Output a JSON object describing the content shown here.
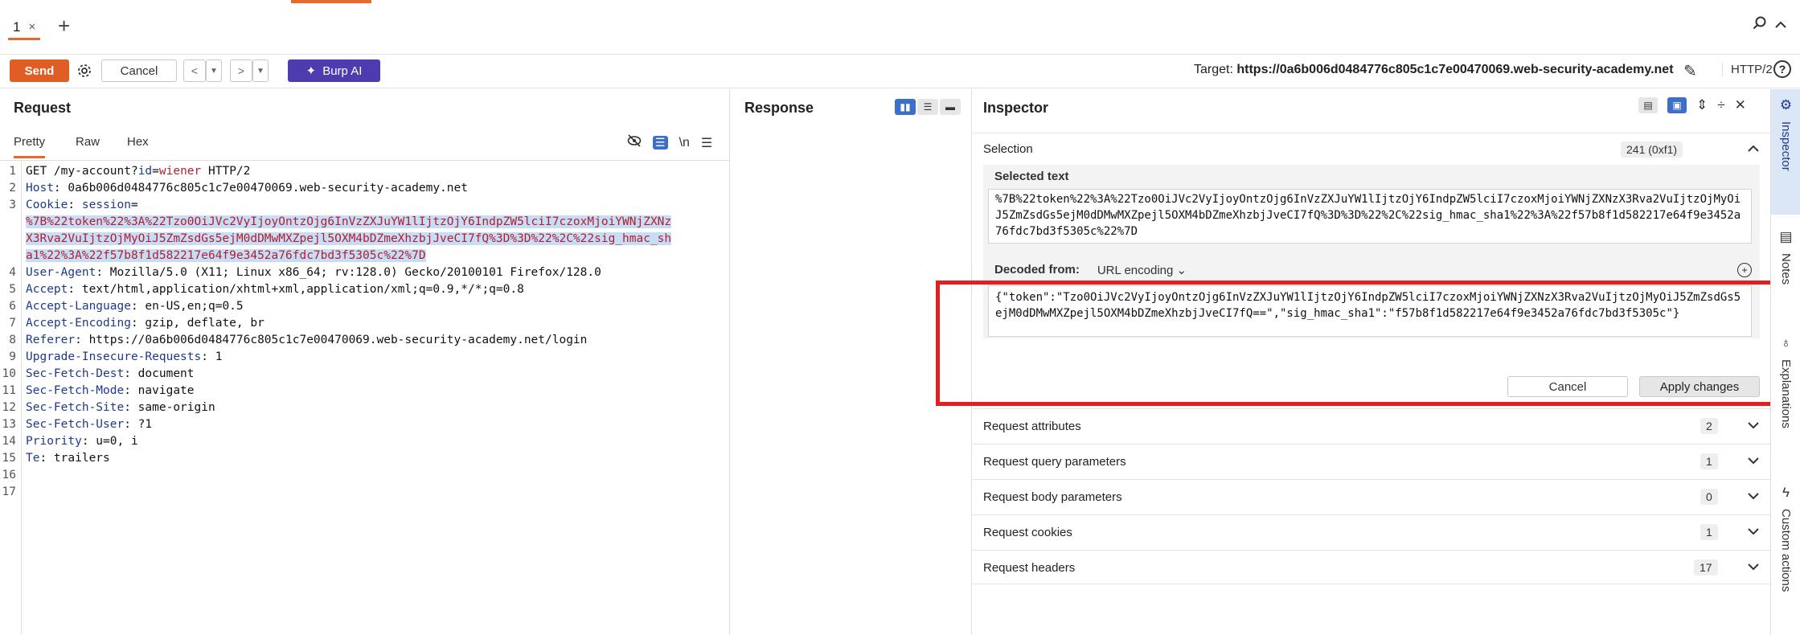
{
  "tabs": {
    "active_tab": "1",
    "close_glyph": "×",
    "add_glyph": "+"
  },
  "toolbar": {
    "send_label": "Send",
    "cancel_label": "Cancel",
    "burp_ai_label": "Burp AI",
    "target_prefix": "Target:",
    "target_url": "https://0a6b006d0484776c805c1c7e00470069.web-security-academy.net",
    "http_version": "HTTP/2",
    "help_glyph": "?"
  },
  "request": {
    "title": "Request",
    "subtabs": [
      "Pretty",
      "Raw",
      "Hex"
    ],
    "newline_toggle": "\\n",
    "lines": [
      {
        "n": "1",
        "parts": [
          [
            "",
            "GET /my-account?"
          ],
          [
            "pr",
            "id"
          ],
          [
            "",
            "="
          ],
          [
            "pv",
            "wiener"
          ],
          [
            "",
            " HTTP/2"
          ]
        ]
      },
      {
        "n": "2",
        "parts": [
          [
            "hn",
            "Host"
          ],
          [
            "",
            ": 0a6b006d0484776c805c1c7e00470069.web-security-academy.net"
          ]
        ]
      },
      {
        "n": "3",
        "parts": [
          [
            "hn",
            "Cookie"
          ],
          [
            "",
            ": "
          ],
          [
            "ck",
            "session"
          ],
          [
            "",
            "="
          ]
        ]
      },
      {
        "n": "",
        "parts": [
          [
            "sel",
            "%7B%22token%22%3A%22Tzo0OiJVc2VyIjoyOntzOjg6InVzZXJuYW1lIjtzOjY6IndpZW5lciI7czoxMjoiYWNjZXNz"
          ]
        ]
      },
      {
        "n": "",
        "parts": [
          [
            "sel",
            "X3Rva2VuIjtzOjMyOiJ5ZmZsdGs5ejM0dDMwMXZpejl5OXM4bDZmeXhzbjJveCI7fQ%3D%3D%22%2C%22sig_hmac_sh"
          ]
        ]
      },
      {
        "n": "",
        "parts": [
          [
            "sel",
            "a1%22%3A%22f57b8f1d582217e64f9e3452a76fdc7bd3f5305c%22%7D"
          ]
        ]
      },
      {
        "n": "4",
        "parts": [
          [
            "hn",
            "User-Agent"
          ],
          [
            "",
            ": Mozilla/5.0 (X11; Linux x86_64; rv:128.0) Gecko/20100101 Firefox/128.0"
          ]
        ]
      },
      {
        "n": "5",
        "parts": [
          [
            "hn",
            "Accept"
          ],
          [
            "",
            ": text/html,application/xhtml+xml,application/xml;q=0.9,*/*;q=0.8"
          ]
        ]
      },
      {
        "n": "6",
        "parts": [
          [
            "hn",
            "Accept-Language"
          ],
          [
            "",
            ": en-US,en;q=0.5"
          ]
        ]
      },
      {
        "n": "7",
        "parts": [
          [
            "hn",
            "Accept-Encoding"
          ],
          [
            "",
            ": gzip, deflate, br"
          ]
        ]
      },
      {
        "n": "8",
        "parts": [
          [
            "hn",
            "Referer"
          ],
          [
            "",
            ": https://0a6b006d0484776c805c1c7e00470069.web-security-academy.net/login"
          ]
        ]
      },
      {
        "n": "9",
        "parts": [
          [
            "hn",
            "Upgrade-Insecure-Requests"
          ],
          [
            "",
            ": 1"
          ]
        ]
      },
      {
        "n": "10",
        "parts": [
          [
            "hn",
            "Sec-Fetch-Dest"
          ],
          [
            "",
            ": document"
          ]
        ]
      },
      {
        "n": "11",
        "parts": [
          [
            "hn",
            "Sec-Fetch-Mode"
          ],
          [
            "",
            ": navigate"
          ]
        ]
      },
      {
        "n": "12",
        "parts": [
          [
            "hn",
            "Sec-Fetch-Site"
          ],
          [
            "",
            ": same-origin"
          ]
        ]
      },
      {
        "n": "13",
        "parts": [
          [
            "hn",
            "Sec-Fetch-User"
          ],
          [
            "",
            ": ?1"
          ]
        ]
      },
      {
        "n": "14",
        "parts": [
          [
            "hn",
            "Priority"
          ],
          [
            "",
            ": u=0, i"
          ]
        ]
      },
      {
        "n": "15",
        "parts": [
          [
            "hn",
            "Te"
          ],
          [
            "",
            ": trailers"
          ]
        ]
      },
      {
        "n": "16",
        "parts": []
      },
      {
        "n": "17",
        "parts": []
      }
    ]
  },
  "response": {
    "title": "Response"
  },
  "inspector": {
    "title": "Inspector",
    "selection_label": "Selection",
    "selection_count": "241 (0xf1)",
    "selected_text_label": "Selected text",
    "selected_text_value": "%7B%22token%22%3A%22Tzo0OiJVc2VyIjoyOntzOjg6InVzZXJuYW1lIjtzOjY6IndpZW5lciI7czoxMjoiYWNjZXNzX3Rva2VuIjtzOjMyOiJ5ZmZsdGs5ejM0dDMwMXZpejl5OXM4bDZmeXhzbjJveCI7fQ%3D%3D%22%2C%22sig_hmac_sha1%22%3A%22f57b8f1d582217e64f9e3452a76fdc7bd3f5305c%22%7D",
    "decoded_from_label": "Decoded from:",
    "decoded_encoding": "URL encoding",
    "decoded_value": "{\"token\":\"Tzo0OiJVc2VyIjoyOntzOjg6InVzZXJuYW1lIjtzOjY6IndpZW5lciI7czoxMjoiYWNjZXNzX3Rva2VuIjtzOjMyOiJ5ZmZsdGs5ejM0dDMwMXZpejl5OXM4bDZmeXhzbjJveCI7fQ==\",\"sig_hmac_sha1\":\"f57b8f1d582217e64f9e3452a76fdc7bd3f5305c\"}",
    "cancel_label": "Cancel",
    "apply_label": "Apply changes",
    "sections": [
      {
        "label": "Request attributes",
        "count": "2"
      },
      {
        "label": "Request query parameters",
        "count": "1"
      },
      {
        "label": "Request body parameters",
        "count": "0"
      },
      {
        "label": "Request cookies",
        "count": "1"
      },
      {
        "label": "Request headers",
        "count": "17"
      }
    ]
  },
  "side_rail": {
    "inspector_label": "Inspector",
    "notes_label": "Notes",
    "explanations_label": "Explanations",
    "custom_actions_label": "Custom actions"
  },
  "colors": {
    "accent": "#e8692d",
    "send": "#e05d26",
    "burp_ai": "#4d3bb0",
    "annotation": "#e02020",
    "selection": "#c7dcf5"
  }
}
